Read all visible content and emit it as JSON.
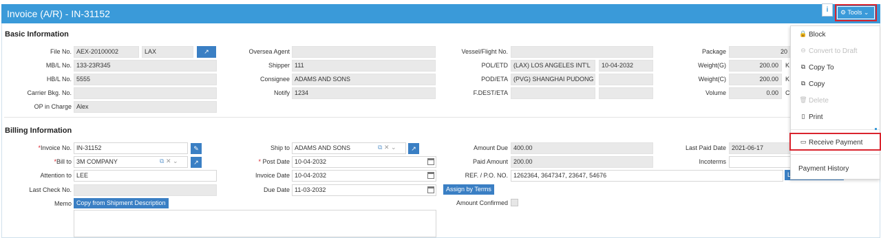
{
  "window": {
    "title": "Invoice (A/R) - IN-31152",
    "info_label": "i",
    "tools_label": "Tools ⌄"
  },
  "basic": {
    "title": "Basic Information",
    "file_no": {
      "label": "File No.",
      "value": "AEX-20100002",
      "value2": "LAX"
    },
    "mbl_no": {
      "label": "MB/L No.",
      "value": "133-23R345"
    },
    "hbl_no": {
      "label": "HB/L No.",
      "value": "5555"
    },
    "carrier_bkg": {
      "label": "Carrier Bkg. No.",
      "value": ""
    },
    "op_in_charge": {
      "label": "OP in Charge",
      "value": "Alex"
    },
    "oversea_agent": {
      "label": "Oversea Agent",
      "value": ""
    },
    "shipper": {
      "label": "Shipper",
      "value": "111"
    },
    "consignee": {
      "label": "Consignee",
      "value": "ADAMS AND SONS"
    },
    "notify": {
      "label": "Notify",
      "value": "1234"
    },
    "vessel": {
      "label": "Vessel/Flight No.",
      "value": ""
    },
    "pol_etd": {
      "label": "POL/ETD",
      "value": "(LAX) LOS ANGELES INT'L",
      "date": "10-04-2032"
    },
    "pod_eta": {
      "label": "POD/ETA",
      "value": "(PVG) SHANGHAI PUDONG",
      "date": ""
    },
    "fdest_eta": {
      "label": "F.DEST/ETA",
      "value": "",
      "date": ""
    },
    "package": {
      "label": "Package",
      "value": "20"
    },
    "weight_g": {
      "label": "Weight(G)",
      "value": "200.00",
      "unit": "K"
    },
    "weight_c": {
      "label": "Weight(C)",
      "value": "200.00",
      "unit": "K"
    },
    "volume": {
      "label": "Volume",
      "value": "0.00",
      "unit": "C"
    }
  },
  "billing": {
    "title": "Billing Information",
    "invoice_no": {
      "label": "Invoice No.",
      "value": "IN-31152"
    },
    "bill_to": {
      "label": "Bill to",
      "value": "3M COMPANY"
    },
    "attention_to": {
      "label": "Attention to",
      "value": "LEE"
    },
    "last_check_no": {
      "label": "Last Check No.",
      "value": ""
    },
    "memo": {
      "label": "Memo",
      "copy_button": "Copy from Shipment Description",
      "value": ""
    },
    "ship_to": {
      "label": "Ship to",
      "value": "ADAMS AND SONS"
    },
    "post_date": {
      "label": "Post Date",
      "value": "10-04-2032"
    },
    "invoice_date": {
      "label": "Invoice Date",
      "value": "10-04-2032"
    },
    "due_date": {
      "label": "Due Date",
      "value": "11-03-2032"
    },
    "assign_by_terms": "Assign by Terms",
    "amount_due": {
      "label": "Amount Due",
      "value": "400.00"
    },
    "paid_amount": {
      "label": "Paid Amount",
      "value": "200.00"
    },
    "ref_po": {
      "label": "REF. / P.O. NO.",
      "value": "1262364, 3647347, 23647, 54676"
    },
    "amount_confirmed": {
      "label": "Amount Confirmed",
      "checked": false
    },
    "last_paid_date": {
      "label": "Last Paid Date",
      "value": "2021-06-17"
    },
    "incoterms": {
      "label": "Incoterms",
      "value": ""
    },
    "hidden_button_fragment": "L"
  },
  "tools_menu": {
    "items": [
      {
        "label": "Block",
        "icon": "lock-icon",
        "glyph": "🔒",
        "enabled": true
      },
      {
        "label": "Convert to Draft",
        "icon": "convert-icon",
        "glyph": "⊖",
        "enabled": false
      },
      {
        "label": "Copy To",
        "icon": "copy-to-icon",
        "glyph": "⧉",
        "enabled": true
      },
      {
        "label": "Copy",
        "icon": "copy-icon",
        "glyph": "⧉",
        "enabled": true
      },
      {
        "label": "Delete",
        "icon": "trash-icon",
        "glyph": "🗑",
        "enabled": false
      },
      {
        "label": "Print",
        "icon": "document-icon",
        "glyph": "▯",
        "enabled": true
      },
      {
        "label": "Receive Payment",
        "icon": "card-icon",
        "glyph": "▭",
        "enabled": true
      },
      {
        "label": "Payment History",
        "icon": "",
        "glyph": "",
        "enabled": true
      }
    ]
  },
  "colors": {
    "header_bg": "#3a9ad9",
    "button_blue": "#3a7fc4",
    "highlight_red": "#d9232d",
    "required": "#d9232d"
  }
}
